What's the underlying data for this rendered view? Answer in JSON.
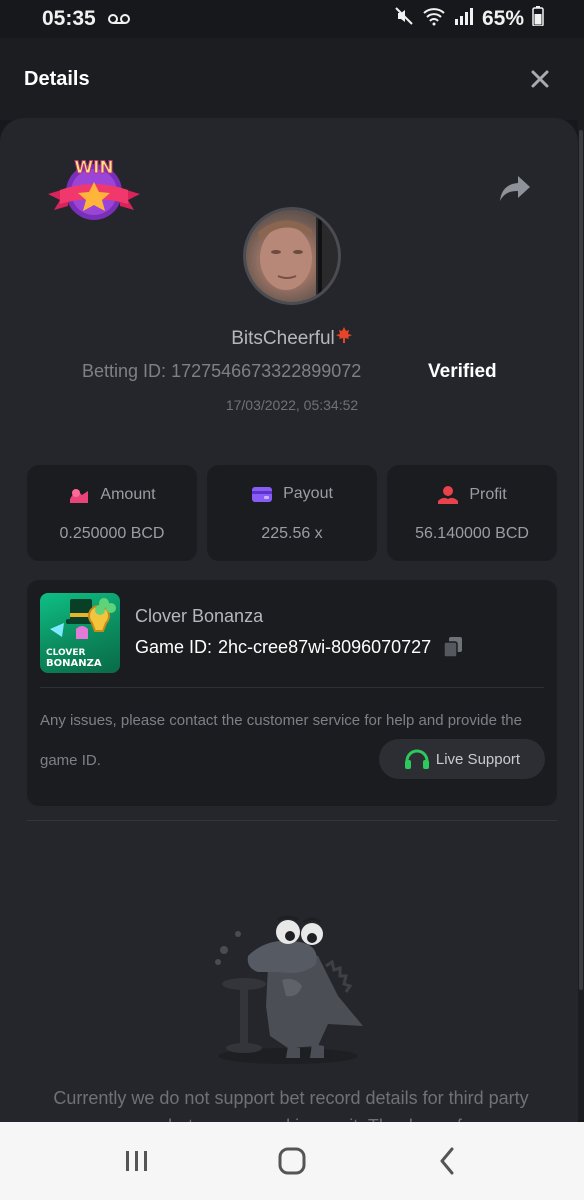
{
  "status_bar": {
    "time": "05:35",
    "battery": "65%",
    "icons": [
      "voicemail-icon",
      "mute-icon",
      "wifi-icon",
      "signal-icon",
      "battery-icon"
    ]
  },
  "header": {
    "title": "Details",
    "close_icon": "close-icon"
  },
  "profile": {
    "badge_text": "WIN",
    "username": "BitsCheerful",
    "betting_id_label": "Betting ID:",
    "betting_id": "1727546673322899072",
    "verified": "Verified",
    "datetime": "17/03/2022, 05:34:52"
  },
  "stats": [
    {
      "label": "Amount",
      "value": "0.250000 BCD",
      "icon": "amount-icon",
      "color": "#e8447a"
    },
    {
      "label": "Payout",
      "value": "225.56 x",
      "icon": "wallet-icon",
      "color": "#8a5cf6"
    },
    {
      "label": "Profit",
      "value": "56.140000 BCD",
      "icon": "profit-icon",
      "color": "#e8424a"
    }
  ],
  "game": {
    "name": "Clover Bonanza",
    "id_label": "Game ID:",
    "id": "2hc-cree87wi-8096070727",
    "thumb_line1": "CLOVER",
    "thumb_line2": "BONANZA",
    "issue_text": "Any issues, please contact the customer service for help and provide the game ID.",
    "support_label": "Live Support",
    "support_color": "#2ec95c"
  },
  "notice": "Currently we do not support bet record details for third party games, but we are working on it. Thank you for",
  "colors": {
    "background": "#17181b",
    "panel": "#24262b",
    "card": "#1b1c20"
  }
}
